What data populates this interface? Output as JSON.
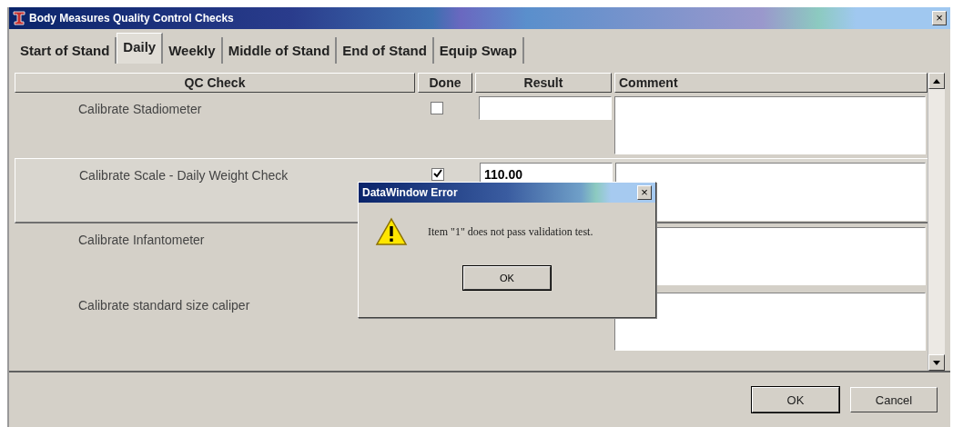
{
  "window": {
    "title": "Body Measures Quality Control Checks",
    "close": "×"
  },
  "tabs": [
    {
      "label": "Start of Stand",
      "selected": false
    },
    {
      "label": "Daily",
      "selected": true
    },
    {
      "label": "Weekly",
      "selected": false
    },
    {
      "label": "Middle of Stand",
      "selected": false
    },
    {
      "label": "End of Stand",
      "selected": false
    },
    {
      "label": "Equip Swap",
      "selected": false
    }
  ],
  "table": {
    "columns": [
      "QC Check",
      "Done",
      "Result",
      "Comment"
    ],
    "rows": [
      {
        "check": "Calibrate Stadiometer",
        "done": false,
        "selected": false
      },
      {
        "check": "Calibrate Scale - Daily Weight Check",
        "done": true,
        "result": "110.00",
        "selected": true
      },
      {
        "check": "Calibrate Infantometer",
        "selected": false
      },
      {
        "check": "Calibrate standard size caliper",
        "selected": false
      }
    ]
  },
  "buttons": [
    "OK",
    "Cancel"
  ],
  "dialog": {
    "title": "DataWindow Error",
    "close": "×",
    "message": "Item \"1\" does not pass validation test.",
    "button": "OK"
  }
}
